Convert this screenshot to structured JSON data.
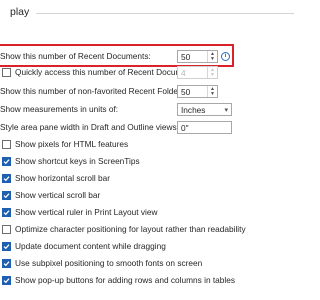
{
  "section_title": "play",
  "recent_documents": {
    "label": "Show this number of Recent Documents:",
    "value": "50",
    "info_icon": "info-icon"
  },
  "quick_access": {
    "label": "Quickly access this number of Recent Documents:",
    "value": "4",
    "checked": false
  },
  "recent_folders": {
    "label": "Show this number of non-favorited Recent Folders:",
    "value": "50"
  },
  "measurements": {
    "label": "Show measurements in units of:",
    "value": "Inches"
  },
  "style_area": {
    "label": "Style area pane width in Draft and Outline views:",
    "value": "0\""
  },
  "checkboxes": [
    {
      "label": "Show pixels for HTML features",
      "checked": false
    },
    {
      "label": "Show shortcut keys in ScreenTips",
      "checked": true
    },
    {
      "label": "Show horizontal scroll bar",
      "checked": true
    },
    {
      "label": "Show vertical scroll bar",
      "checked": true
    },
    {
      "label": "Show vertical ruler in Print Layout view",
      "checked": true
    },
    {
      "label": "Optimize character positioning for layout rather than readability",
      "checked": false
    },
    {
      "label": "Update document content while dragging",
      "checked": true
    },
    {
      "label": "Use subpixel positioning to smooth fonts on screen",
      "checked": true
    },
    {
      "label": "Show pop-up buttons for adding rows and columns in tables",
      "checked": true
    }
  ],
  "colors": {
    "highlight": "#d9222a",
    "checkbox_checked": "#1f5fb0"
  }
}
